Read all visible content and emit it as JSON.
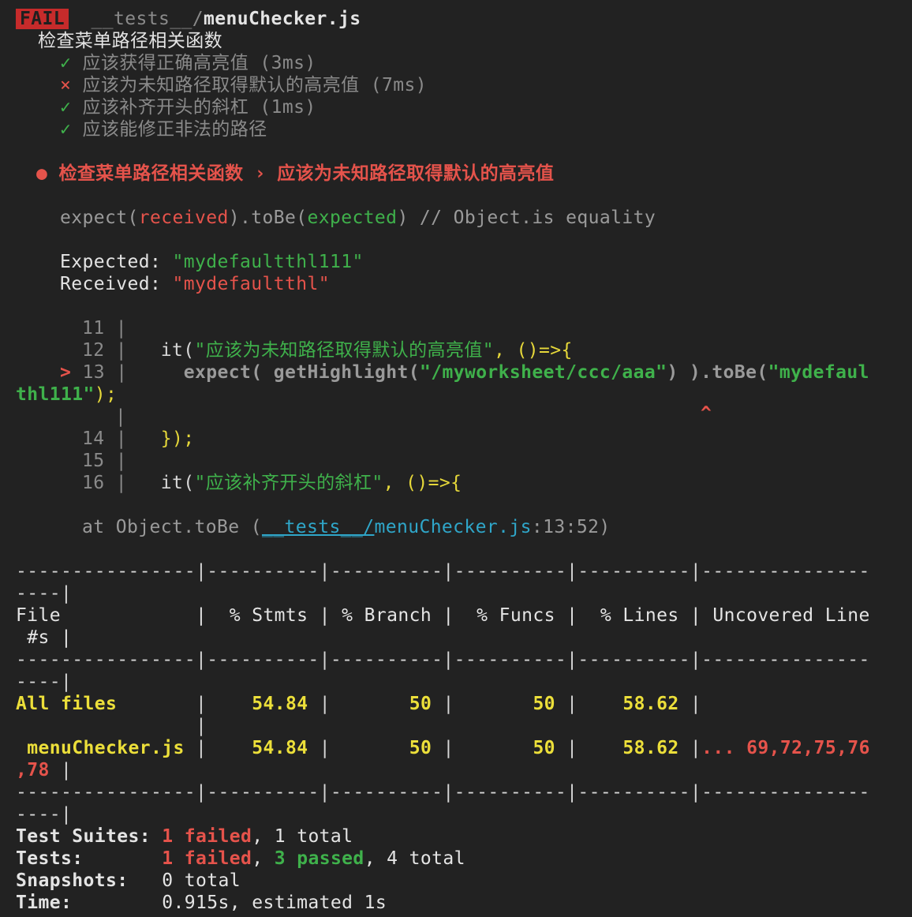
{
  "header": {
    "badge": "FAIL",
    "path_dir": "__tests__/",
    "path_file": "menuChecker.js"
  },
  "suite": {
    "title": "检查菜单路径相关函数",
    "tests": [
      {
        "mark": "✓",
        "text": "应该获得正确高亮值 (3ms)",
        "status": "pass"
      },
      {
        "mark": "×",
        "text": "应该为未知路径取得默认的高亮值 (7ms)",
        "status": "fail"
      },
      {
        "mark": "✓",
        "text": "应该补齐开头的斜杠 (1ms)",
        "status": "pass"
      },
      {
        "mark": "✓",
        "text": "应该能修正非法的路径",
        "status": "pass"
      }
    ]
  },
  "failure": {
    "bullet": "●",
    "title": "检查菜单路径相关函数 › 应该为未知路径取得默认的高亮值",
    "expect_a": "expect(",
    "expect_received": "received",
    "expect_b": ").toBe(",
    "expect_expected": "expected",
    "expect_c": ") // Object.is equality",
    "expected_label": "Expected: ",
    "expected_value": "\"mydefaultthl111\"",
    "received_label": "Received: ",
    "received_value": "\"mydefaultthl\""
  },
  "code_frame": {
    "line11": "11",
    "line12": "12",
    "line12_a": "it(",
    "line12_str": "\"应该为未知路径取得默认的高亮值\"",
    "line12_b": ", ()=>{",
    "arrow": ">",
    "line13": "13",
    "line13_a": "expect( getHighlight(",
    "line13_str": "\"/myworksheet/ccc/aaa\"",
    "line13_b": ") ).toBe(",
    "line13_str2": "\"mydefaul",
    "wrap_str": "thl111\"",
    "wrap_end": ");",
    "caret": "^",
    "line14": "14",
    "line14_code": "});",
    "line15": "15",
    "line16": "16",
    "line16_a": "it(",
    "line16_str": "\"应该补齐开头的斜杠\"",
    "line16_b": ", ()=>{",
    "pipe": "|"
  },
  "stack": {
    "prefix": "at Object.toBe (",
    "dir": "__tests__/",
    "file": "menuChecker.js",
    "suffix": ":13:52)"
  },
  "coverage": {
    "separator": "----------------|----------|----------|----------|----------|---------------",
    "separator_wrap": "----|",
    "header": "File            |  % Stmts | % Branch |  % Funcs |  % Lines | Uncovered Line",
    "header_wrap": " #s |",
    "all_name": "All files       ",
    "all_stmts": "54.84",
    "all_branch": "50",
    "all_funcs": "50",
    "all_lines": "58.62",
    "all_wrap": "                |",
    "file_name": " menuChecker.js ",
    "file_stmts": "54.84",
    "file_branch": "50",
    "file_funcs": "50",
    "file_lines": "58.62",
    "file_uncovered": "... 69,72,75,76",
    "file_uncovered_wrap": ",78",
    "file_wrap_end": " |"
  },
  "summary": {
    "suites_label": "Test Suites: ",
    "suites_failed": "1 failed",
    "suites_total": ", 1 total",
    "tests_label": "Tests:       ",
    "tests_failed": "1 failed",
    "tests_sep": ", ",
    "tests_passed": "3 passed",
    "tests_total": ", 4 total",
    "snap_label": "Snapshots:   ",
    "snap_value": "0 total",
    "time_label": "Time:        ",
    "time_value": "0.915s, estimated 1s"
  },
  "colors": {
    "background": "#222222",
    "fail": "#c62b2b",
    "pass": "#3fb14b",
    "error": "#e5534b",
    "coverage_value": "#ecdf3a",
    "link": "#2fa6c9"
  }
}
